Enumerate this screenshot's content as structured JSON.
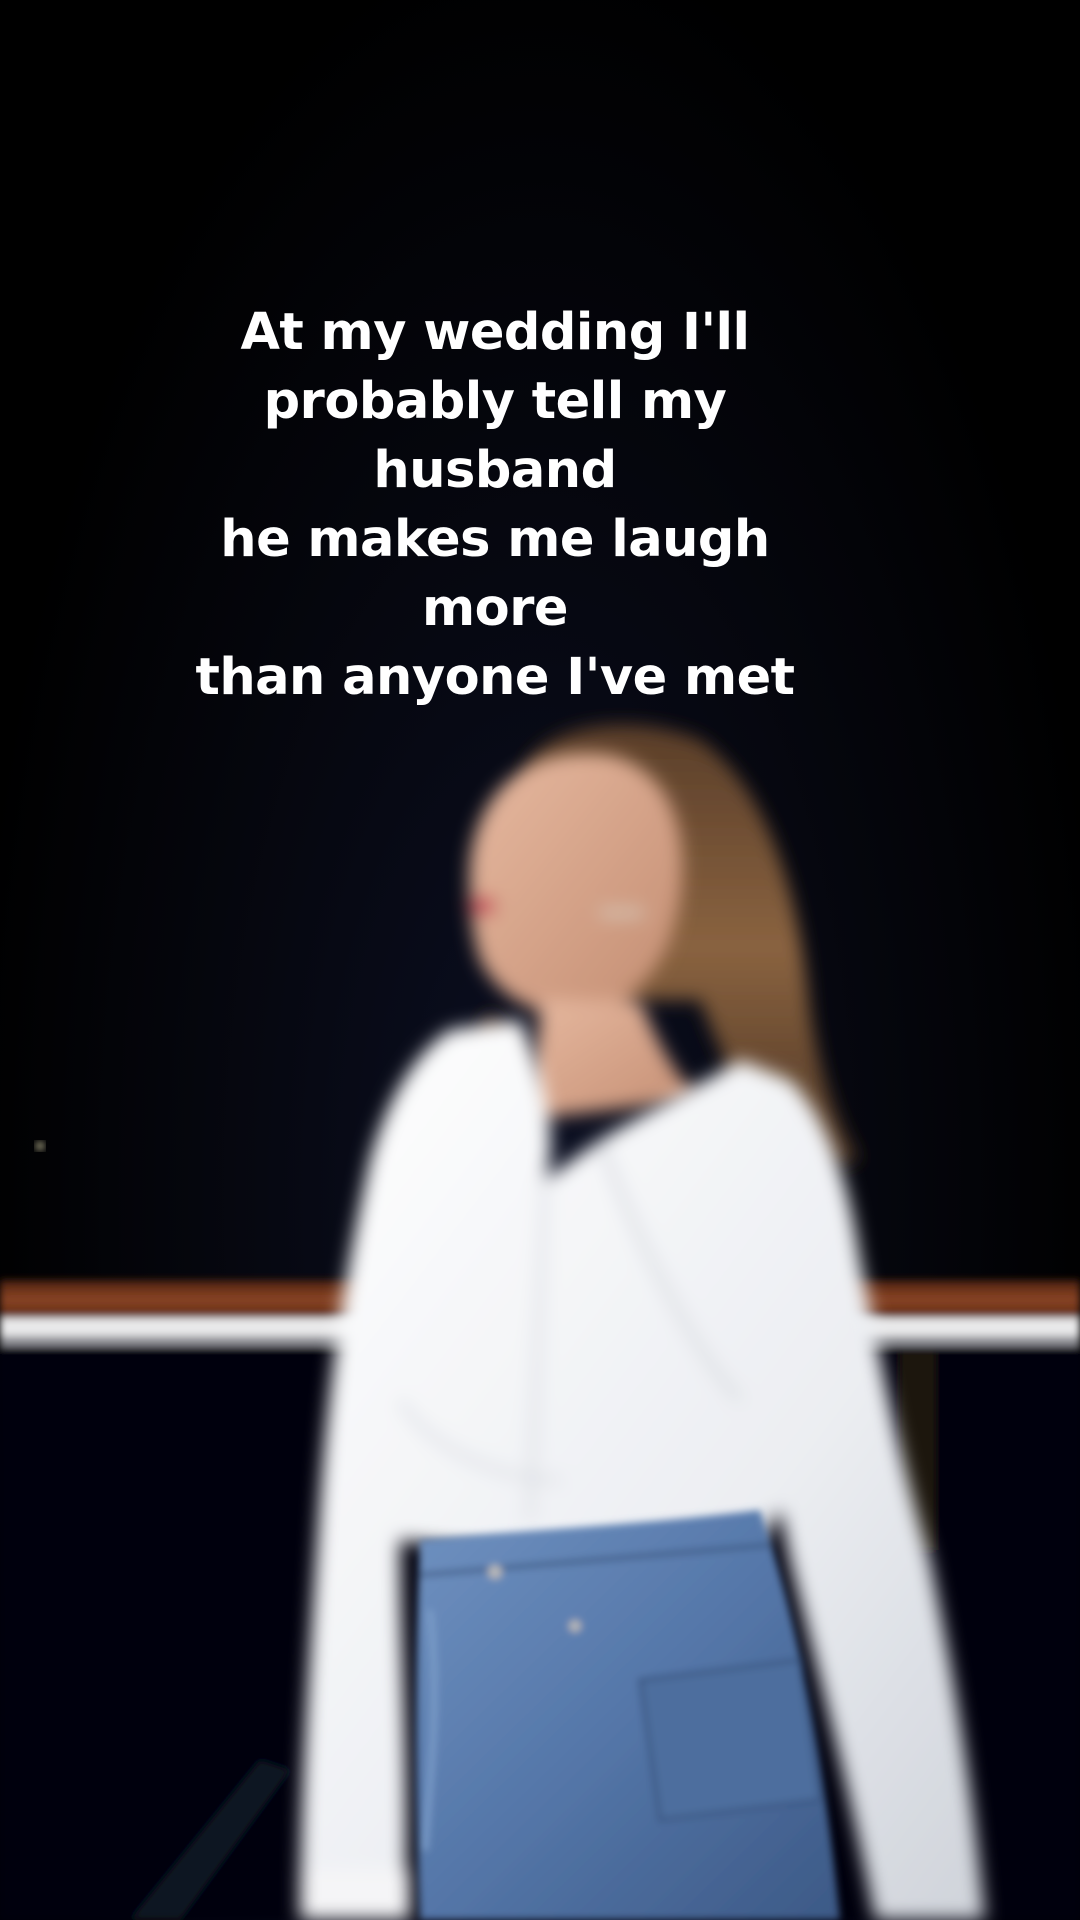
{
  "caption": {
    "text": "At my wedding I'll\nprobably tell my husband\nhe makes me laugh more\nthan anyone I've met"
  },
  "photo": {
    "subject": "woman-in-white-shirt-and-denim-skirt",
    "colors": {
      "background": "#000000",
      "rail_wood": "#7a3a1e",
      "rail_white": "#e8e8e8",
      "shirt": "#f2f2f4",
      "denim": "#5b7fb0",
      "hair": "#7a5434",
      "skin": "#d9a98f"
    }
  }
}
